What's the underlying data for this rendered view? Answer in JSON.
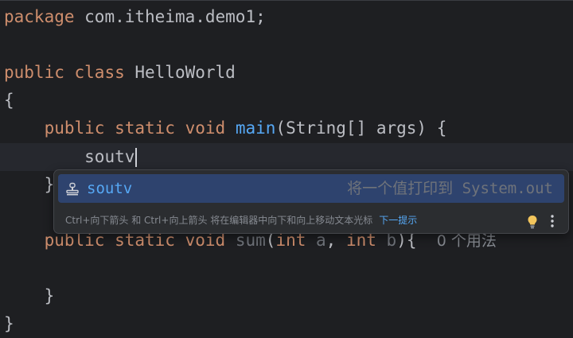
{
  "code": {
    "line1": {
      "keyword": "package",
      "rest": " com.itheima.demo1;"
    },
    "line3": {
      "kw1": "public",
      "kw2": "class",
      "name": " HelloWorld"
    },
    "line4": {
      "text": "{"
    },
    "line5": {
      "kw1": "public",
      "kw2": "static",
      "kw3": "void",
      "fn": "main",
      "rest": "(String[] args) {"
    },
    "line6": {
      "typed": "soutv"
    },
    "line7": {
      "text": "}"
    },
    "line9": {
      "kw1": "public",
      "kw2": "static",
      "kw3": "void",
      "fn": "sum",
      "paren_open": "(",
      "kw4": "int",
      "param1": " a",
      "comma": ", ",
      "kw5": "int",
      "param2": " b",
      "close": "){",
      "usage_hint": "0 个用法"
    },
    "line11": {
      "text": "}"
    },
    "line12": {
      "text": "}"
    }
  },
  "completion": {
    "item_label": "soutv",
    "item_description": "将一个值打印到 System.out",
    "footer_hint": "Ctrl+向下箭头 和 Ctrl+向上箭头 将在编辑器中向下和向上移动文本光标",
    "footer_link": "下一提示",
    "item_icon": "template-stamp-icon",
    "bulb_icon": "lightbulb-icon",
    "more_icon": "more-vertical-icon"
  },
  "colors": {
    "background": "#1e1f22",
    "keyword": "#cf8e6d",
    "function": "#56a8f5",
    "text": "#bcbec4",
    "popup_selection": "#2e436e",
    "bulb": "#f2c55c"
  }
}
